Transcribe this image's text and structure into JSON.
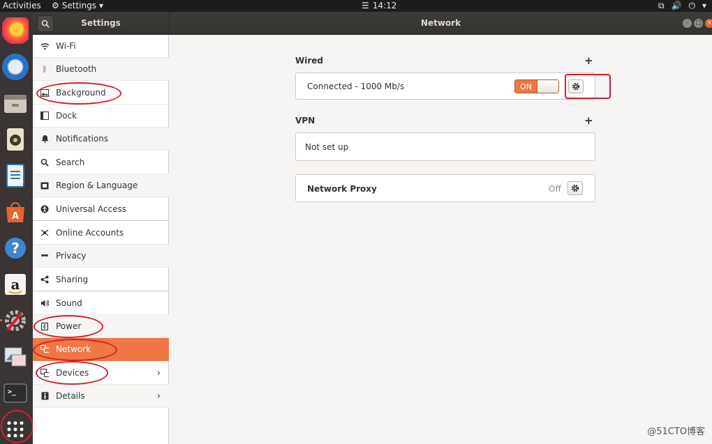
{
  "topbar": {
    "activities": "Activities",
    "app_menu": "Settings",
    "clock": "14:12"
  },
  "headerbar": {
    "sidebar_title": "Settings",
    "panel_title": "Network"
  },
  "sidebar": {
    "items": [
      {
        "label": "Wi-Fi",
        "icon": "wifi-icon"
      },
      {
        "label": "Bluetooth",
        "icon": "bluetooth-icon"
      },
      {
        "label": "Background",
        "icon": "background-icon"
      },
      {
        "label": "Dock",
        "icon": "dock-icon"
      },
      {
        "label": "Notifications",
        "icon": "bell-icon"
      },
      {
        "label": "Search",
        "icon": "search-icon"
      },
      {
        "label": "Region & Language",
        "icon": "region-icon"
      },
      {
        "label": "Universal Access",
        "icon": "accessibility-icon"
      },
      {
        "label": "Online Accounts",
        "icon": "online-accounts-icon"
      },
      {
        "label": "Privacy",
        "icon": "privacy-icon"
      },
      {
        "label": "Sharing",
        "icon": "share-icon"
      },
      {
        "label": "Sound",
        "icon": "speaker-icon"
      },
      {
        "label": "Power",
        "icon": "power-icon"
      },
      {
        "label": "Network",
        "icon": "network-icon",
        "active": true
      },
      {
        "label": "Devices",
        "icon": "devices-icon"
      },
      {
        "label": "Details",
        "icon": "info-icon"
      }
    ]
  },
  "wired": {
    "title": "Wired",
    "add": "+",
    "status": "Connected - 1000 Mb/s",
    "switch": "ON"
  },
  "vpn": {
    "title": "VPN",
    "add": "+",
    "status": "Not set up"
  },
  "proxy": {
    "label": "Network Proxy",
    "state": "Off"
  },
  "watermark": "@51CTO博客",
  "colors": {
    "accent": "#f07746",
    "annotation": "#d3202a",
    "dock": "#3a3434",
    "headerbar": "#3c3b37"
  }
}
